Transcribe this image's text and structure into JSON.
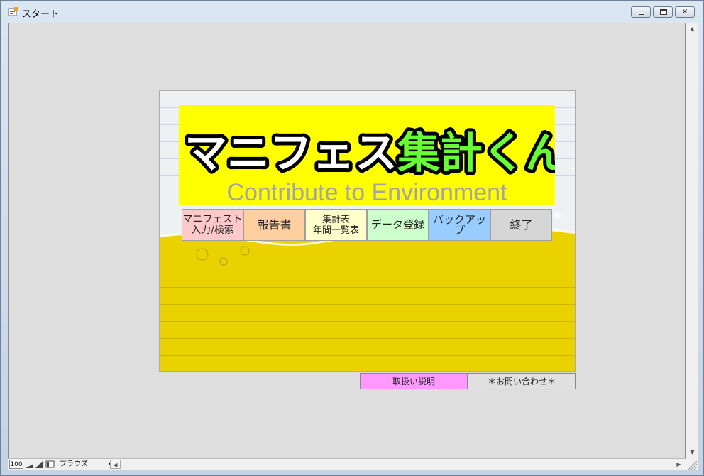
{
  "window": {
    "title": "スタート"
  },
  "banner": {
    "logo_main": "マニフェスト",
    "logo_accent": "集計くん",
    "subtitle": "Contribute to Environment"
  },
  "menu": [
    {
      "line1": "マニフェスト",
      "line2": "入力/検索",
      "color": "#ffc9c9"
    },
    {
      "line1": "報告書",
      "line2": "",
      "color": "#ffcfa0"
    },
    {
      "line1": "集計表",
      "line2": "年間一覧表",
      "color": "#ffffcc"
    },
    {
      "line1": "データ登録",
      "line2": "",
      "color": "#ccffcc"
    },
    {
      "line1": "バックアップ",
      "line2": "",
      "color": "#99ccff"
    },
    {
      "line1": "終了",
      "line2": "",
      "color": "#d6d6d6"
    }
  ],
  "footer": {
    "manual_label": "取扱い説明",
    "manual_color": "#ff99ff",
    "contact_label": "＊お問い合わせ＊",
    "contact_color": "#e0e0e0"
  },
  "statusbar": {
    "zoom": "100",
    "mode": "ブラウズ"
  },
  "colors": {
    "banner": "#ffff00",
    "accent": "#66ff33",
    "liquid": "#e9d200"
  }
}
